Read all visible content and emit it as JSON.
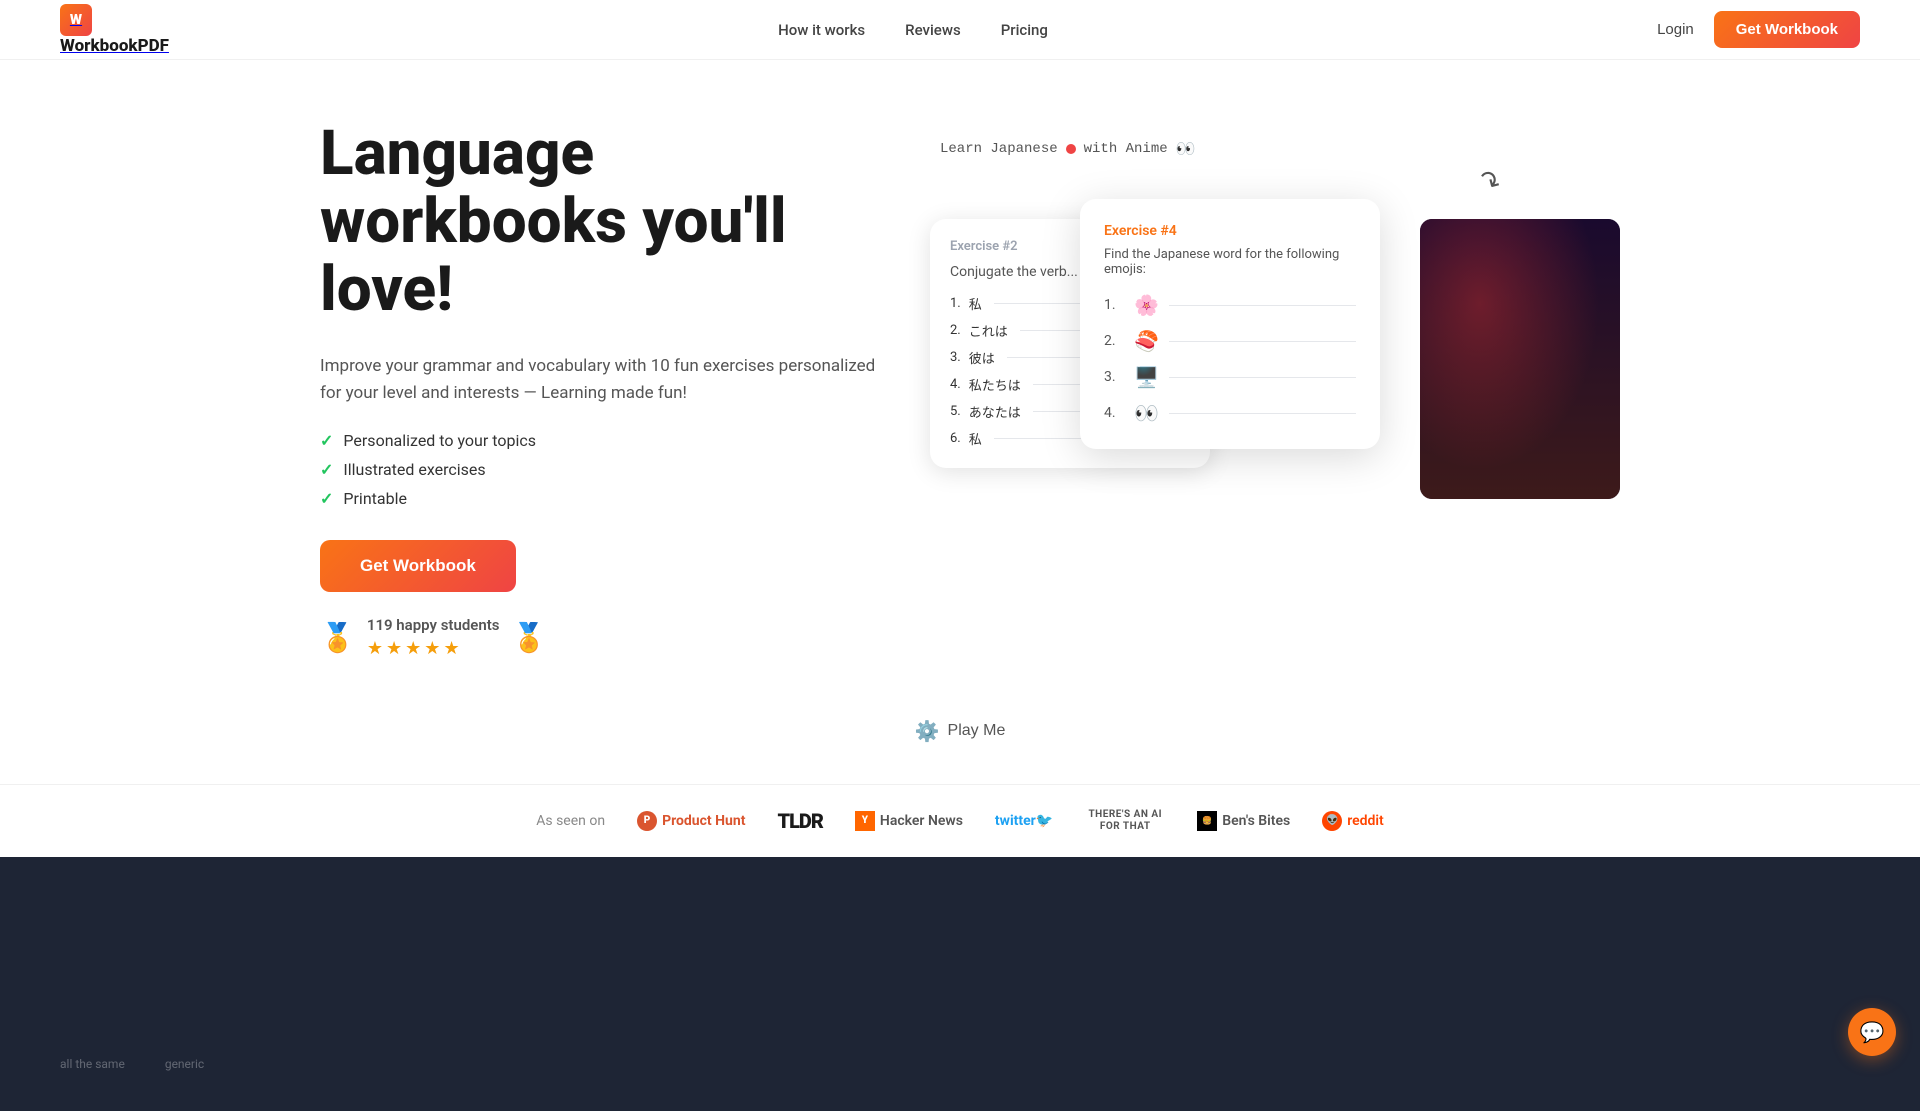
{
  "nav": {
    "logo_text": "WorkbookPDF",
    "links": [
      {
        "label": "How it works",
        "id": "how-it-works"
      },
      {
        "label": "Reviews",
        "id": "reviews"
      },
      {
        "label": "Pricing",
        "id": "pricing"
      }
    ],
    "login_label": "Login",
    "cta_label": "Get Workbook"
  },
  "hero": {
    "title": "Language workbooks you'll love!",
    "description": "Improve your grammar and vocabulary with 10 fun exercises personalized for your level and interests — Learning made fun!",
    "features": [
      "Personalized to your topics",
      "Illustrated exercises",
      "Printable"
    ],
    "cta_label": "Get Workbook",
    "social_proof": {
      "students_count": "119 happy students"
    }
  },
  "demo": {
    "annotation": "Learn Japanese",
    "annotation2": "with Anime",
    "exercise_bg": {
      "label": "Exercise #2",
      "title": "Conjugate the verb...",
      "rows": [
        {
          "num": "1.",
          "text": "私"
        },
        {
          "num": "2.",
          "text": "これは"
        },
        {
          "num": "3.",
          "text": "彼は"
        },
        {
          "num": "4.",
          "text": "私たちは"
        },
        {
          "num": "5.",
          "text": "あなたは"
        },
        {
          "num": "6.",
          "text": "私"
        }
      ]
    },
    "exercise_fg": {
      "label": "Exercise #4",
      "subtitle": "Find the Japanese word for the following emojis:",
      "items": [
        {
          "num": "1.",
          "emoji": "🌸"
        },
        {
          "num": "2.",
          "emoji": "🍣"
        },
        {
          "num": "3.",
          "emoji": "🖥️"
        },
        {
          "num": "4.",
          "emoji": "👀"
        }
      ]
    }
  },
  "play": {
    "label": "Play Me"
  },
  "as_seen": {
    "label": "As seen on",
    "brands": [
      {
        "name": "Product Hunt",
        "id": "product-hunt"
      },
      {
        "name": "TLDR",
        "id": "tldr"
      },
      {
        "name": "Hacker News",
        "id": "hacker-news"
      },
      {
        "name": "twitter",
        "id": "twitter"
      },
      {
        "name": "THERE'S AN AI FOR THAT",
        "id": "ai-for-that"
      },
      {
        "name": "Ben's Bites",
        "id": "bens-bites"
      },
      {
        "name": "reddit",
        "id": "reddit"
      }
    ]
  },
  "footer": {
    "bottom_labels": [
      "all the same",
      "generic"
    ]
  }
}
